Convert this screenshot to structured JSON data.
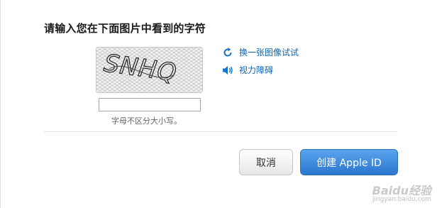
{
  "dialog": {
    "heading": "请输入您在下面图片中看到的字符",
    "captcha": {
      "image_text": "SNHQ",
      "input_value": "",
      "hint": "字母不区分大小写。"
    },
    "links": {
      "refresh_label": "换一张图像试试",
      "refresh_icon": "refresh-icon",
      "audio_label": "视力障碍",
      "audio_icon": "speaker-icon"
    },
    "buttons": {
      "cancel_label": "取消",
      "create_label": "创建 Apple ID"
    }
  },
  "watermark": {
    "brand": "Baidu经验",
    "url": "jingyan.baidu.com"
  },
  "colors": {
    "link": "#0a66b7",
    "primary_button": "#2b76cf"
  }
}
